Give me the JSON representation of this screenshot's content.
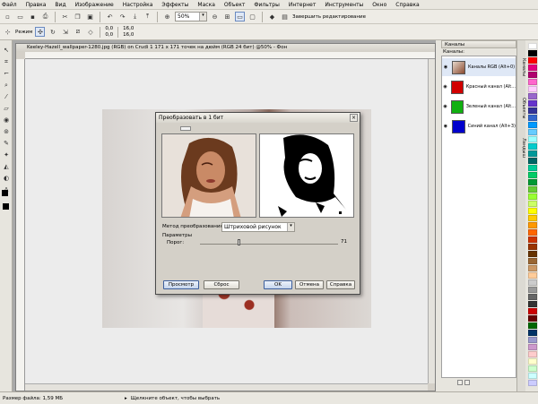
{
  "menu": [
    "Файл",
    "Правка",
    "Вид",
    "Изображение",
    "Настройка",
    "Эффекты",
    "Маска",
    "Объект",
    "Фильтры",
    "Интернет",
    "Инструменты",
    "Окно",
    "Справка"
  ],
  "toolbar": {
    "zoom_value": "50%",
    "finish_edit_label": "Завершить редактирование",
    "mode_label": "Режим",
    "coord_x1": "0,0",
    "coord_y1": "0,0",
    "coord_x2": "16,0",
    "coord_y2": "16,0"
  },
  "document": {
    "title": "Keeley-Hazell_wallpaper-1280.jpg (RGB) on Crudi 1 171 x 171 точек на дюйм (RGB 24 бит) @50% - Фон"
  },
  "dialog": {
    "title": "Преобразовать в 1 бит",
    "close_glyph": "×",
    "method_label": "Метод преобразования:",
    "method_value": "Штриховой рисунок",
    "params_label": "Параметры",
    "threshold_label": "Порог:",
    "threshold_value": "71",
    "threshold_fraction": 0.28,
    "preview_button": "Просмотр",
    "reset_button": "Сброс",
    "ok_button": "OK",
    "cancel_button": "Отмена",
    "help_button": "Справка"
  },
  "panel": {
    "dock_title": "Каналы",
    "list_title": "Каналы:",
    "channels": [
      {
        "label": "Каналы RGB (Alt+0)",
        "color": "#b35a3c"
      },
      {
        "label": "Красный канал (Alt...",
        "color": "#d10000"
      },
      {
        "label": "Зеленый канал (Alt...",
        "color": "#11b011"
      },
      {
        "label": "Синий канал (Alt+3)",
        "color": "#0000cc"
      }
    ],
    "vertical_tabs": [
      "Каналы",
      "Объекты",
      "Ландыш"
    ]
  },
  "status": {
    "file_size": "Размер файла: 1,59 МБ",
    "hint": "Щелкните объект, чтобы выбрать"
  },
  "palette_colors": [
    "#ffffff",
    "#000000",
    "#ff0000",
    "#e4007f",
    "#b0006e",
    "#ff66cc",
    "#ffccff",
    "#9966cc",
    "#6633cc",
    "#333399",
    "#3366cc",
    "#0099ff",
    "#66ccff",
    "#99ffff",
    "#00cccc",
    "#009999",
    "#006666",
    "#00cc99",
    "#00cc66",
    "#009933",
    "#66cc33",
    "#99ff33",
    "#ccff66",
    "#ffff00",
    "#ffcc00",
    "#ff9900",
    "#ff6600",
    "#cc3300",
    "#993300",
    "#663300",
    "#996633",
    "#cc9966",
    "#ffcc99",
    "#cccccc",
    "#999999",
    "#666666",
    "#333333",
    "#cc0000",
    "#660000",
    "#006600",
    "#003366",
    "#9999cc",
    "#cc99cc",
    "#ffcccc",
    "#ffffcc",
    "#ccffcc",
    "#ccffff",
    "#ccccff"
  ]
}
